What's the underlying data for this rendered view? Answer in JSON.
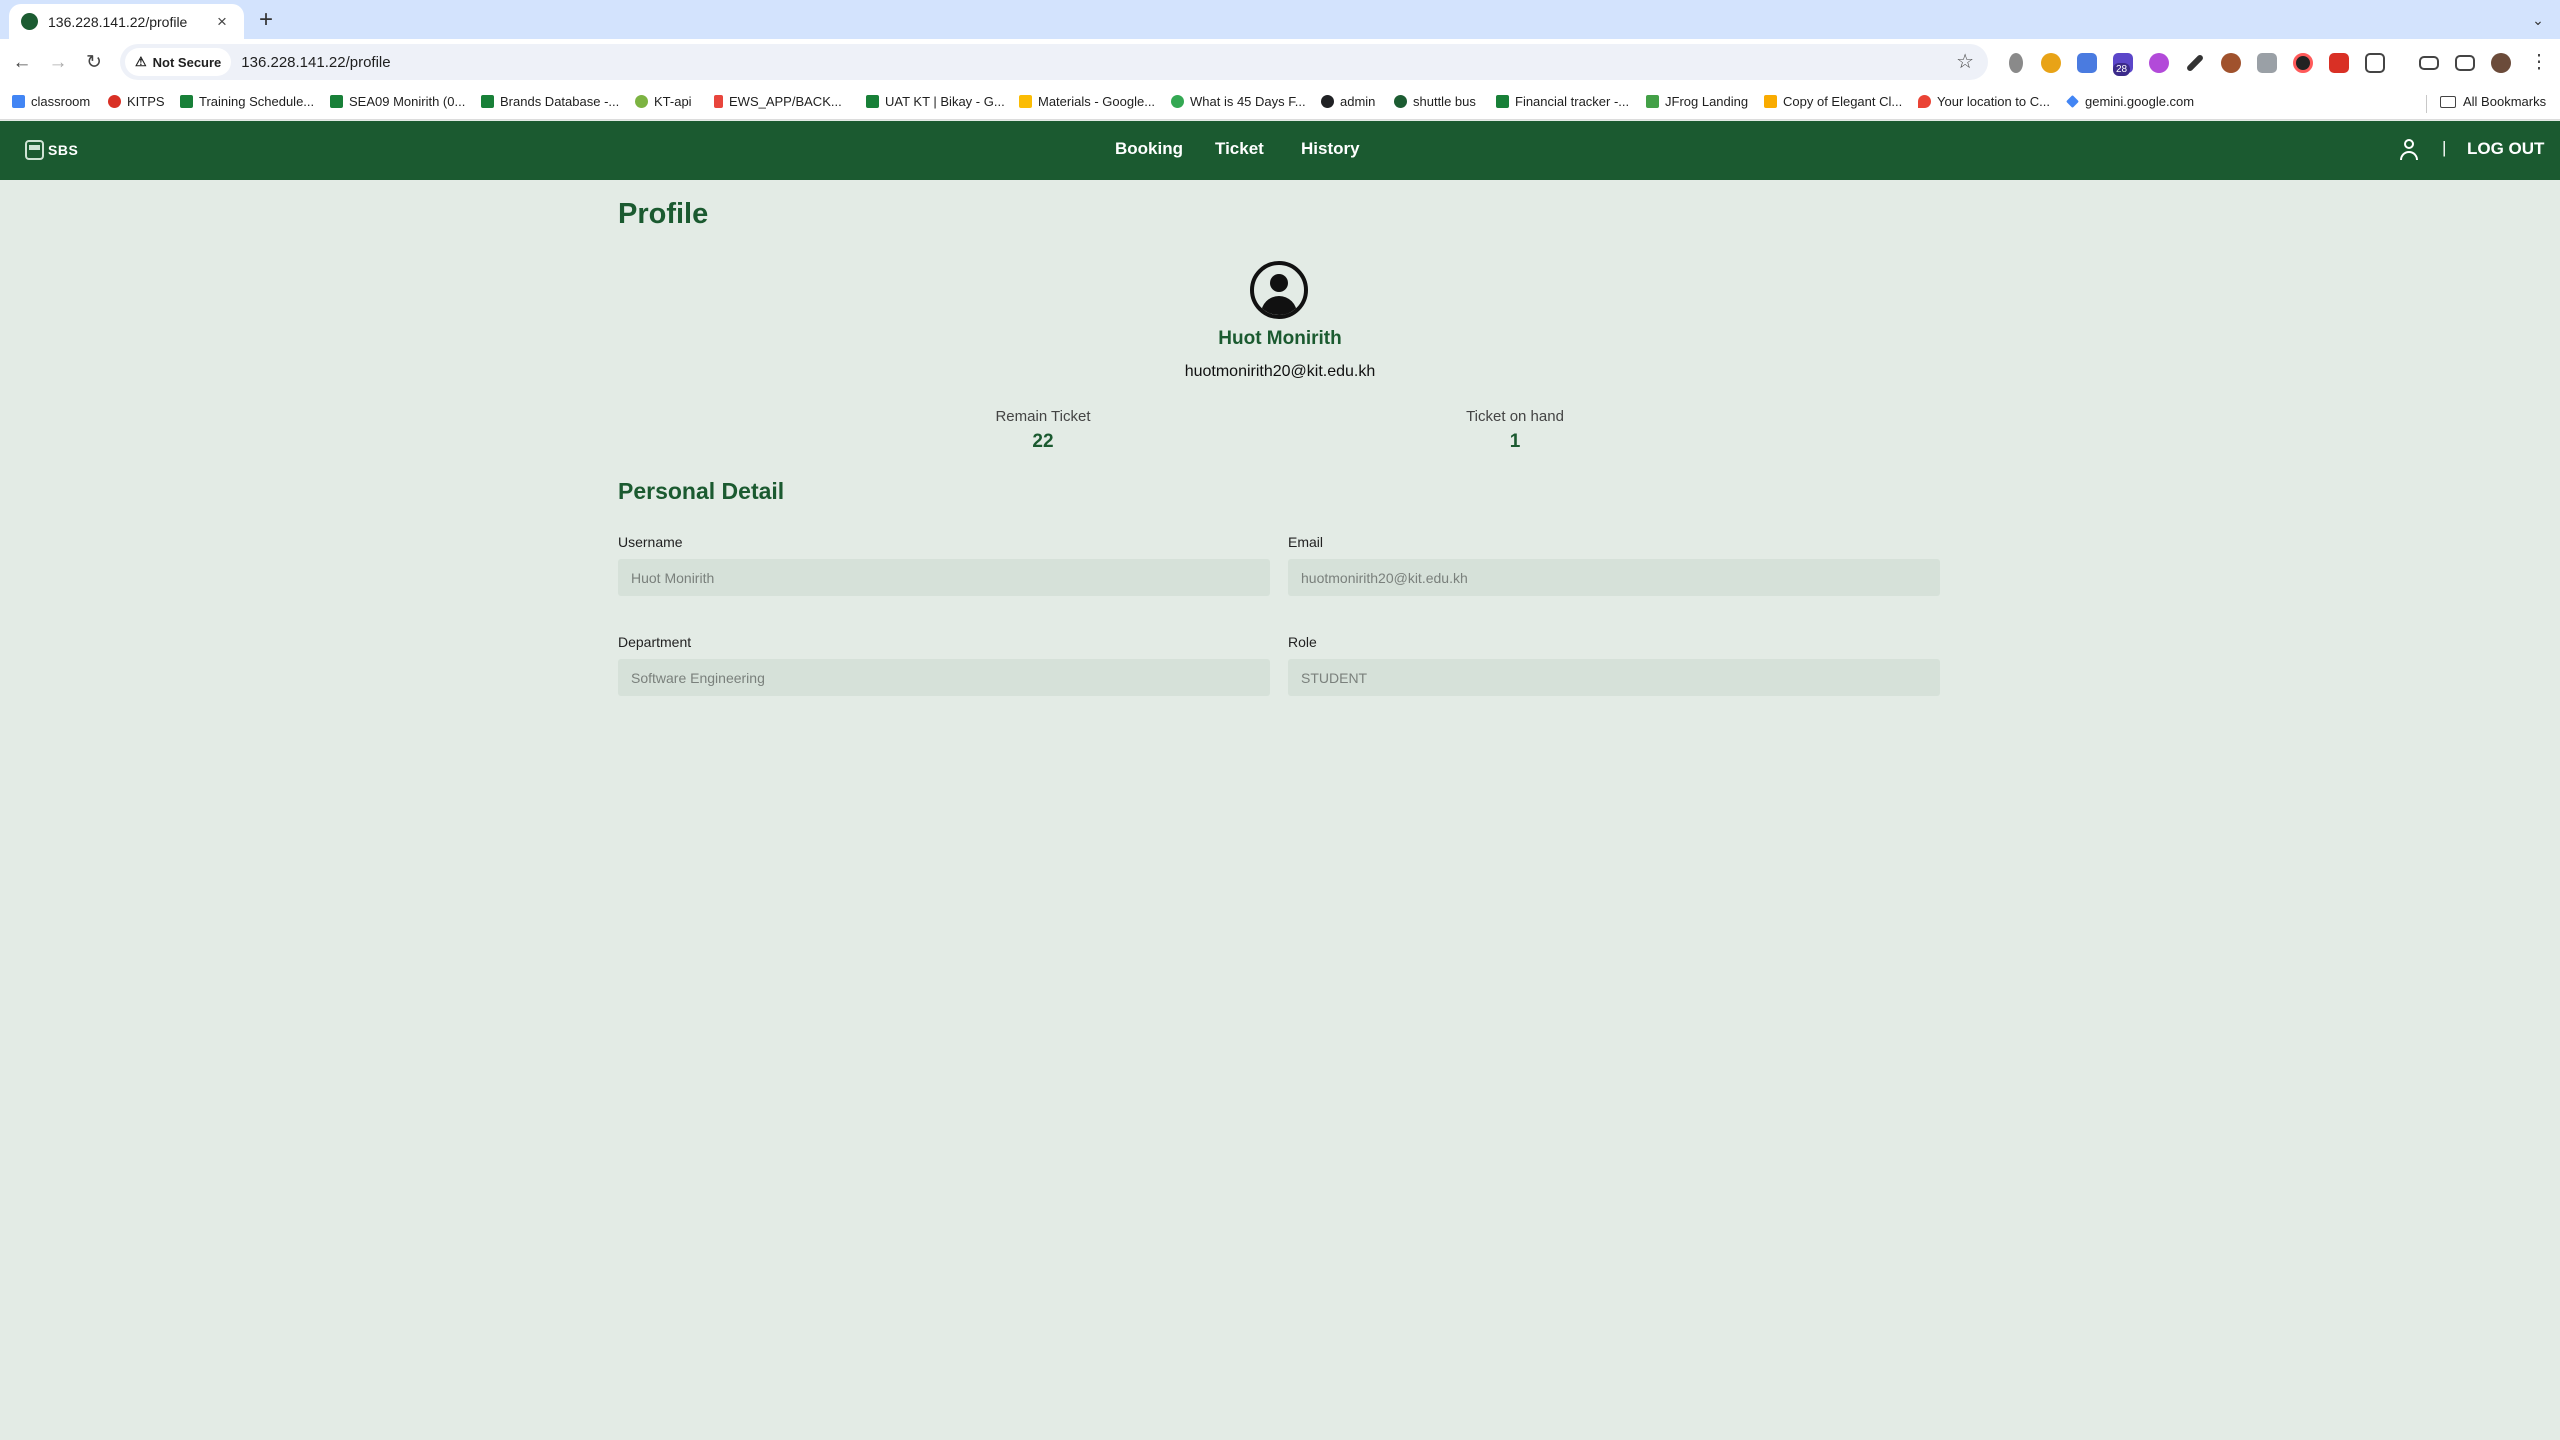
{
  "browser": {
    "tab_title": "136.228.141.22/profile",
    "security_label": "Not Secure",
    "url": "136.228.141.22/profile",
    "extension_badge": "28",
    "bookmarks": [
      {
        "label": "classroom",
        "color": "#4285f4"
      },
      {
        "label": "KITPS",
        "color": "#d93025"
      },
      {
        "label": "Training Schedule...",
        "color": "#188038"
      },
      {
        "label": "SEA09 Monirith (0...",
        "color": "#188038"
      },
      {
        "label": "Brands Database -...",
        "color": "#188038"
      },
      {
        "label": "KT-api",
        "color": "#7cb342"
      },
      {
        "label": "EWS_APP/BACK...",
        "color": "#e8453c"
      },
      {
        "label": "UAT KT | Bikay - G...",
        "color": "#188038"
      },
      {
        "label": "Materials - Google...",
        "color": "#fbbc04"
      },
      {
        "label": "What is 45 Days F...",
        "color": "#34a853"
      },
      {
        "label": "admin",
        "color": "#202124"
      },
      {
        "label": "shuttle bus",
        "color": "#1c5c32"
      },
      {
        "label": "Financial tracker -...",
        "color": "#188038"
      },
      {
        "label": "JFrog Landing",
        "color": "#43a047"
      },
      {
        "label": "Copy of Elegant Cl...",
        "color": "#f9ab00"
      },
      {
        "label": "Your location to C...",
        "color": "#ea4335"
      },
      {
        "label": "gemini.google.com",
        "color": "#4285f4"
      }
    ],
    "all_bookmarks_label": "All Bookmarks"
  },
  "app": {
    "brand": "SBS",
    "nav": {
      "booking": "Booking",
      "ticket": "Ticket",
      "history": "History"
    },
    "divider": "|",
    "logout": "LOG OUT"
  },
  "profile": {
    "page_title": "Profile",
    "name": "Huot Monirith",
    "email": "huotmonirith20@kit.edu.kh",
    "remain_ticket_label": "Remain Ticket",
    "remain_ticket_value": "22",
    "ticket_on_hand_label": "Ticket on hand",
    "ticket_on_hand_value": "1"
  },
  "personal_detail": {
    "section_title": "Personal Detail",
    "username_label": "Username",
    "username_value": "Huot Monirith",
    "email_label": "Email",
    "email_value": "huotmonirith20@kit.edu.kh",
    "department_label": "Department",
    "department_value": "Software Engineering",
    "role_label": "Role",
    "role_value": "STUDENT"
  },
  "colors": {
    "brand_green": "#1b5a30",
    "page_background": "#e3ebe5",
    "input_background": "#d6e1d9"
  }
}
